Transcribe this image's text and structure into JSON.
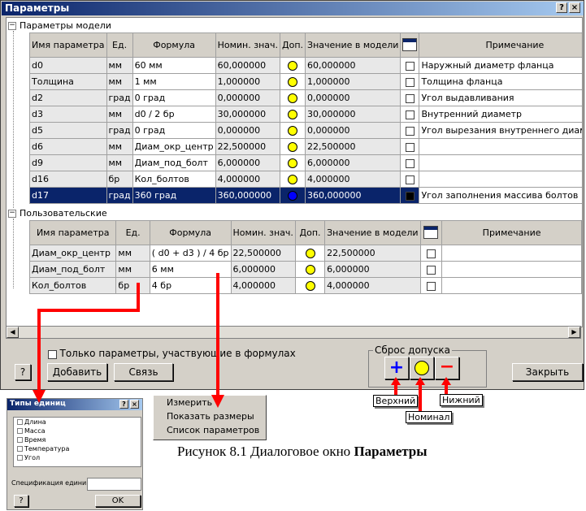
{
  "window": {
    "title": "Параметры",
    "help_label": "?",
    "close_label": "×"
  },
  "model_section": {
    "label": "Параметры модели",
    "toggle": "−"
  },
  "user_section": {
    "label": "Пользовательские",
    "toggle": "−"
  },
  "columns": [
    "Имя параметра",
    "Ед.",
    "Формула",
    "Номин. знач.",
    "Доп.",
    "Значение в модели",
    "",
    "Примечание"
  ],
  "model_rows": [
    {
      "name": "d0",
      "unit": "мм",
      "formula": "60 мм",
      "nominal": "60,000000",
      "tol": "yellow",
      "value": "60,000000",
      "note": "Наружный диаметр фланца"
    },
    {
      "name": "Толщина",
      "unit": "мм",
      "formula": "1 мм",
      "nominal": "1,000000",
      "tol": "yellow",
      "value": "1,000000",
      "note": "Толщина фланца"
    },
    {
      "name": "d2",
      "unit": "град",
      "formula": "0 град",
      "nominal": "0,000000",
      "tol": "yellow",
      "value": "0,000000",
      "note": "Угол выдавливания"
    },
    {
      "name": "d3",
      "unit": "мм",
      "formula": "d0 / 2 бр",
      "nominal": "30,000000",
      "tol": "yellow",
      "value": "30,000000",
      "note": "Внутренний диаметр"
    },
    {
      "name": "d5",
      "unit": "град",
      "formula": "0 град",
      "nominal": "0,000000",
      "tol": "yellow",
      "value": "0,000000",
      "note": "Угол вырезания внутреннего диаметра"
    },
    {
      "name": "d6",
      "unit": "мм",
      "formula": "Диам_окр_центр",
      "nominal": "22,500000",
      "tol": "yellow",
      "value": "22,500000",
      "note": ""
    },
    {
      "name": "d9",
      "unit": "мм",
      "formula": "Диам_под_болт",
      "nominal": "6,000000",
      "tol": "yellow",
      "value": "6,000000",
      "note": ""
    },
    {
      "name": "d16",
      "unit": "бр",
      "formula": "Кол_болтов",
      "nominal": "4,000000",
      "tol": "yellow",
      "value": "4,000000",
      "note": ""
    },
    {
      "name": "d17",
      "unit": "град",
      "formula": "360 град",
      "nominal": "360,000000",
      "tol": "blue",
      "value": "360,000000",
      "note": "Угол заполнения массива болтов",
      "selected": true
    }
  ],
  "user_rows": [
    {
      "name": "Диам_окр_центр",
      "unit": "мм",
      "formula": "( d0 + d3 ) / 4 бр",
      "nominal": "22,500000",
      "tol": "yellow",
      "value": "22,500000",
      "note": ""
    },
    {
      "name": "Диам_под_болт",
      "unit": "мм",
      "formula": "6 мм",
      "nominal": "6,000000",
      "tol": "yellow",
      "value": "6,000000",
      "note": ""
    },
    {
      "name": "Кол_болтов",
      "unit": "бр",
      "formula": "4 бр",
      "nominal": "4,000000",
      "tol": "yellow",
      "value": "4,000000",
      "note": ""
    }
  ],
  "filter_checkbox_label": "Только параметры, участвующие в формулах",
  "buttons": {
    "help": "?",
    "add": "Добавить",
    "link": "Связь",
    "close": "Закрыть"
  },
  "tolerance_group": {
    "label": "Сброс допуска",
    "upper_symbol": "+",
    "lower_symbol": "−"
  },
  "callouts": {
    "upper": "Верхний",
    "nominal": "Номинал",
    "lower": "Нижний"
  },
  "units_dialog": {
    "title": "Типы единиц",
    "items": [
      "Длина",
      "Масса",
      "Время",
      "Температура",
      "Угол"
    ],
    "spec_label": "Спецификация единиц",
    "ok": "OK",
    "help": "?"
  },
  "context_menu": [
    "Измерить",
    "Показать размеры",
    "Список параметров"
  ],
  "caption": {
    "prefix": "Рисунок 8.1 Диалоговое окно ",
    "bold": "Параметры"
  },
  "colors": {
    "arrow": "#ff0000",
    "selection": "#0a246a",
    "title_bar": "#0a246a",
    "tolerance_nominal": "#ffff00",
    "plus": "#0000ff",
    "minus": "#ff0000"
  }
}
